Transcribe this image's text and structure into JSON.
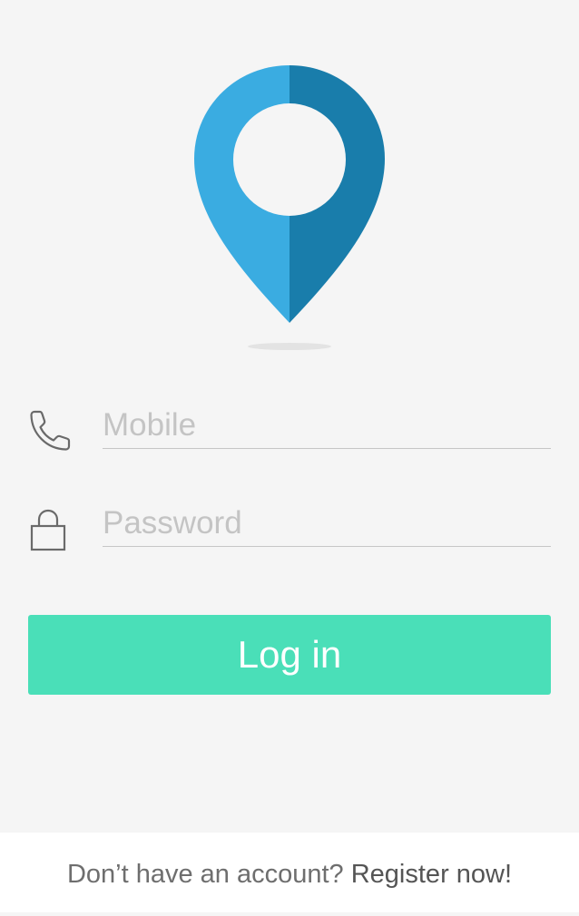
{
  "logo": {
    "icon": "location-pin-icon",
    "colors": {
      "light": "#3aace1",
      "dark": "#197dab"
    }
  },
  "form": {
    "mobile": {
      "icon": "phone-icon",
      "placeholder": "Mobile",
      "value": ""
    },
    "password": {
      "icon": "lock-icon",
      "placeholder": "Password",
      "value": ""
    }
  },
  "login_button": {
    "label": "Log in",
    "color": "#4adfb8"
  },
  "footer": {
    "prompt": "Don’t have an account?",
    "register_link": "Register now!"
  }
}
